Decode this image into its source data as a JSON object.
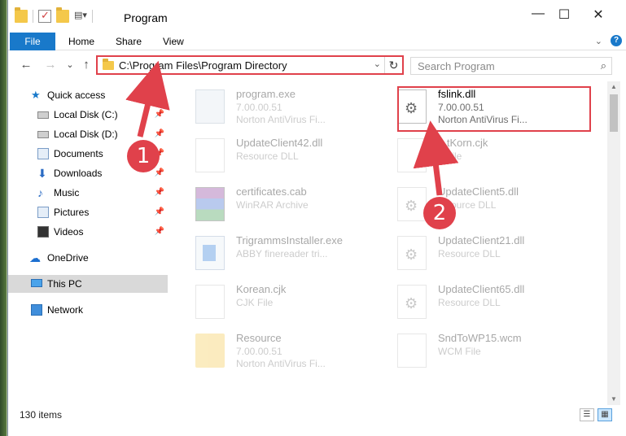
{
  "window": {
    "title": "Program",
    "controls": {
      "minimize": "—",
      "maximize": "☐",
      "close": "✕"
    }
  },
  "ribbon": {
    "tabs": [
      "File",
      "Home",
      "Share",
      "View"
    ],
    "collapse_icon": "chevron-down-icon",
    "help_label": "?"
  },
  "navigation": {
    "back": "←",
    "forward": "→",
    "recent": "⌄",
    "up": "↑",
    "address": "C:\\Program Files\\Program Directory",
    "search_placeholder": "Search Program"
  },
  "sidebar": {
    "items": [
      {
        "label": "Quick access",
        "icon": "star-icon"
      },
      {
        "label": "Local Disk (C:)",
        "icon": "disk-icon",
        "pinned": true
      },
      {
        "label": "Local Disk (D:)",
        "icon": "disk-icon",
        "pinned": true
      },
      {
        "label": "Documents",
        "icon": "documents-icon",
        "pinned": true
      },
      {
        "label": "Downloads",
        "icon": "downloads-icon",
        "pinned": true
      },
      {
        "label": "Music",
        "icon": "music-icon",
        "pinned": true
      },
      {
        "label": "Pictures",
        "icon": "pictures-icon",
        "pinned": true
      },
      {
        "label": "Videos",
        "icon": "videos-icon",
        "pinned": true
      },
      {
        "label": "OneDrive",
        "icon": "onedrive-icon"
      },
      {
        "label": "This PC",
        "icon": "pc-icon",
        "selected": true
      },
      {
        "label": "Network",
        "icon": "network-icon"
      }
    ]
  },
  "files": {
    "left": [
      {
        "name": "program.exe",
        "line2": "7.00.00.51",
        "line3": "Norton AntiVirus Fi...",
        "type": "exe"
      },
      {
        "name": "UpdateClient42.dll",
        "line2": "Resource DLL",
        "line3": "",
        "type": "doc"
      },
      {
        "name": "certificates.cab",
        "line2": "WinRAR Archive",
        "line3": "",
        "type": "rar"
      },
      {
        "name": "TrigrammsInstaller.exe",
        "line2": "ABBY finereader tri...",
        "line3": "",
        "type": "installer"
      },
      {
        "name": "Korean.cjk",
        "line2": "CJK File",
        "line3": "",
        "type": "doc"
      },
      {
        "name": "Resource",
        "line2": "7.00.00.51",
        "line3": "Norton AntiVirus Fi...",
        "type": "folder"
      }
    ],
    "right": [
      {
        "name": "fslink.dll",
        "line2": "7.00.00.51",
        "line3": "Norton AntiVirus Fi...",
        "type": "dll",
        "highlighted": true
      },
      {
        "name": "...tKorn.cjk",
        "line2": "...File",
        "line3": "",
        "type": "doc"
      },
      {
        "name": "UpdateClient5.dll",
        "line2": "...source DLL",
        "line3": "",
        "type": "dll"
      },
      {
        "name": "UpdateClient21.dll",
        "line2": "Resource DLL",
        "line3": "",
        "type": "dll"
      },
      {
        "name": "UpdateClient65.dll",
        "line2": "Resource DLL",
        "line3": "",
        "type": "dll"
      },
      {
        "name": "SndToWP15.wcm",
        "line2": "WCM File",
        "line3": "",
        "type": "doc"
      }
    ]
  },
  "status": {
    "item_count": "130 items",
    "views": [
      "details-view",
      "large-icons-view"
    ]
  },
  "annotations": {
    "marker1": "1",
    "marker2": "2",
    "accent_color": "#e0414b"
  }
}
